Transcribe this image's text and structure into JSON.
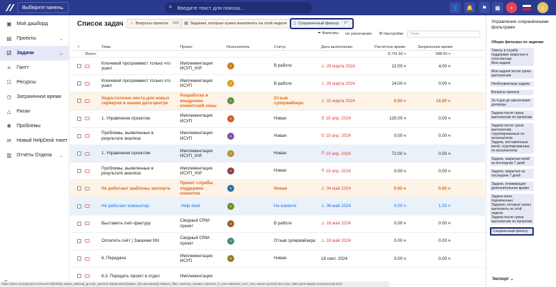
{
  "topbar": {
    "panel_select": "Выберите панель",
    "search_placeholder": "Введите текст для поиска..."
  },
  "sidebar": {
    "items": [
      {
        "label": "Мой дашборд"
      },
      {
        "label": "Проекты"
      },
      {
        "label": "Задачи"
      },
      {
        "label": "Гантт"
      },
      {
        "label": "Ресурсы"
      },
      {
        "label": "Затраченное время"
      },
      {
        "label": "Риски"
      },
      {
        "label": "Проблемы"
      },
      {
        "label": "Новый HelpDesk тикет"
      },
      {
        "label": "Отчёты Отдела"
      }
    ]
  },
  "main": {
    "title": "Список задач",
    "title_count": "(509)",
    "tabs": [
      {
        "label": "Вопросы проекта",
        "count": "509"
      },
      {
        "label": "Задания, которые нужно выполнить на этой неделе",
        "count": "10"
      },
      {
        "label": "Сохраненный фильтр",
        "count": "27"
      }
    ],
    "tools": {
      "filters": "Фильтры",
      "default": "по умолчанию",
      "settings": "Настройки",
      "topic_placeholder": "Тема"
    },
    "columns": {
      "topic": "Тема",
      "project": "Проект",
      "executor": "Исполнитель",
      "status": "Статус",
      "due": "Дата выполнения",
      "est": "Расчётное время",
      "spent": "Затраченное время"
    },
    "totals": {
      "label": "Всего:",
      "est": "8,741.50 ч",
      "spent": "588.50 ч"
    },
    "rows": [
      {
        "topic": "Ключевой программист только что ушел",
        "project": "Имплементация ИСУП_УпР",
        "status": "В работе",
        "due": "28 марта 2024",
        "est": "12.00 ч",
        "spent": "4.00 ч",
        "style": "",
        "due_style": "red",
        "due_icon": "⚠"
      },
      {
        "topic": "Ключевой программист только что ушел",
        "project": "Имплементация ИСУП",
        "status": "В работе",
        "due": "29 марта 2024",
        "est": "24.00 ч",
        "spent": "0.00 ч",
        "style": "",
        "due_style": "red",
        "due_icon": "⚠"
      },
      {
        "topic": "Недостаточно места для новых серверов в нашем дата-центре",
        "project": "Разработка и внедрение клиентской зоны",
        "status": "Отзыв супервайзера",
        "due": "31 марта 2024",
        "est": "0.00 ч",
        "spent": "14.00 ч",
        "style": "orange",
        "due_style": "red",
        "due_icon": "⚠"
      },
      {
        "topic": "1. Управление проектом",
        "project": "Имплементация ИСУП",
        "status": "Новая",
        "due": "19 апр. 2024",
        "est": "120.00 ч",
        "spent": "0.00 ч",
        "style": "",
        "due_style": "red",
        "due_icon": "⏱"
      },
      {
        "topic": "Проблемы, выявленные в результате анализа",
        "project": "Имплементация ИСУП",
        "status": "Новая",
        "due": "19 апр. 2024",
        "est": "0.00 ч",
        "spent": "0.00 ч",
        "style": "",
        "due_style": "red",
        "due_icon": "⏱"
      },
      {
        "topic": "1. Управление проектом",
        "project": "Имплементация ИСУП_УпР",
        "status": "Новая",
        "due": "19 апр. 2024",
        "est": "72.00 ч",
        "spent": "0.00 ч",
        "style": "blue",
        "due_style": "red",
        "due_icon": "⏱"
      },
      {
        "topic": "Проблемы, выявленные в результате анализа",
        "project": "Имплементация ИСУП_УпР",
        "status": "Новая",
        "due": "19 апр. 2024",
        "est": "0.00 ч",
        "spent": "0.00 ч",
        "style": "",
        "due_style": "red",
        "due_icon": "⏱"
      },
      {
        "topic": "Не работают шаблоны экспорта",
        "project": "Проект службы поддержки клиентов",
        "status": "Новая",
        "due": "04 май 2024",
        "est": "0.00 ч",
        "spent": "0.00 ч",
        "style": "orange",
        "due_style": "red",
        "due_icon": "⚠"
      },
      {
        "topic": "Не работает компьютер",
        "project": ".Help desk",
        "status": "На клиенте",
        "due": "06 май 2024",
        "est": "0.00 ч",
        "spent": "1.00 ч",
        "style": "blue",
        "due_style": "blue-t",
        "due_icon": "⚠"
      },
      {
        "topic": "Выставить счёт-фактуру",
        "project": "Сводный CRM-проект",
        "status": "В работе",
        "due": "16 май 2024",
        "est": "0.00 ч",
        "spent": "0.00 ч",
        "style": "",
        "due_style": "red",
        "due_icon": "⚠"
      },
      {
        "topic": "Оплатить счёт | Заказчик NN",
        "project": "Сводный CRM-проект",
        "status": "Отзыв супервайзера",
        "due": "16 май 2024",
        "est": "0.00 ч",
        "spent": "0.00 ч",
        "style": "",
        "due_style": "red",
        "due_icon": "⚠"
      },
      {
        "topic": "6. Передача",
        "project": "Имплементация ИСУП",
        "status": "Новая",
        "due": "18 сент. 2024",
        "est": "0.00 ч",
        "spent": "0.00 ч",
        "style": "",
        "due_style": "",
        "due_icon": ""
      },
      {
        "topic": "6.3. Передать проект в отдел",
        "project": "Имплементация",
        "status": "",
        "due": "",
        "est": "",
        "spent": "",
        "style": "",
        "due_style": "",
        "due_icon": ""
      }
    ]
  },
  "right": {
    "title": "Управление сохранёнными фильтрами",
    "subtitle": "Общие фильтры по задачам",
    "filters": [
      "Тикеты в службу поддержки закрытые в этом месяце",
      "Мои задачи",
      "Мои задачи после срока выполнения",
      "Необновленные задачи",
      "Вопросы проекта",
      "За 4 дня до заключения договора",
      "Задачи после срока выполнения по проектам",
      "Задачи после срока выполнения, сгруппированные по исполнителю",
      "Задачи, поставленные мной, сгруппированные по исполнителю",
      "Задачи, закрытые мной за последние 7 дней",
      "Задачи, закрытые за последние 7 дней",
      "Задачи, отнимающие дополнительное время",
      "Задачи моих подчиненных",
      "Задания, которые нужно выполнить на этой неделе",
      "Задачи после срока выполнения по проектам",
      "Сохраненный фильтр"
    ],
    "export": "Экспорт"
  },
  "statusbar": "https://demo.inoutproject.ru/issues?&fields[]=status_id&load_groups_opened=0&operators[status_id]=o&outputs[]=list&set_filter=1&show_avatars=1&show_in_tree=0&show_sum_row=1&sort=priority:desc,due_date,parent&type=EasyIssueQuery#"
}
